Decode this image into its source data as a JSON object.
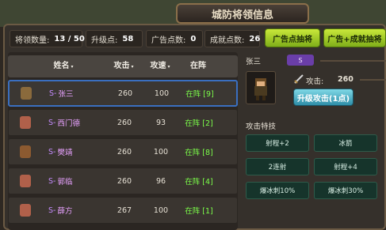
{
  "title": "城防将领信息",
  "stats": {
    "general_count_label": "将领数量:",
    "general_count_value": "13 / 50",
    "upgrade_points_label": "升级点:",
    "upgrade_points_value": "58",
    "ad_points_label": "广告点数:",
    "ad_points_value": "0",
    "achieve_points_label": "成就点数:",
    "achieve_points_value": "26"
  },
  "buttons": {
    "ad_draw": "广告点抽将",
    "ad_achieve_draw": "广告+成就抽将",
    "upgrade_attack": "升级攻击(1点)"
  },
  "table": {
    "headers": {
      "name": "姓名",
      "attack": "攻击",
      "speed": "攻速",
      "status": "在阵"
    },
    "sort_arrow": "▾",
    "rows": [
      {
        "prefix": "S-",
        "name": "张三",
        "attack": "260",
        "speed": "100",
        "status": "在阵 [9]",
        "avatar_color": "#8a6a3c"
      },
      {
        "prefix": "S-",
        "name": "西门德",
        "attack": "260",
        "speed": "93",
        "status": "在阵 [2]",
        "avatar_color": "#b0604a"
      },
      {
        "prefix": "S-",
        "name": "樊靖",
        "attack": "260",
        "speed": "100",
        "status": "在阵 [8]",
        "avatar_color": "#8c5a30"
      },
      {
        "prefix": "S-",
        "name": "郭临",
        "attack": "260",
        "speed": "96",
        "status": "在阵 [4]",
        "avatar_color": "#b0604a"
      },
      {
        "prefix": "S-",
        "name": "薛方",
        "attack": "267",
        "speed": "100",
        "status": "在阵 [1]",
        "avatar_color": "#b0604a"
      }
    ]
  },
  "detail": {
    "name": "张三",
    "grade": "S",
    "attack_label": "攻击:",
    "attack_value": "260",
    "skills_title": "攻击特技",
    "skills": [
      "射程+2",
      "冰箭",
      "2连射",
      "射程+4",
      "爆冰刺10%",
      "爆冰刺30%"
    ]
  },
  "colors": {
    "accent_green": "#9fd22e",
    "status_green": "#7cff4a",
    "name_purple": "#e8a2ff",
    "upgrade_blue": "#3aa3bf"
  }
}
